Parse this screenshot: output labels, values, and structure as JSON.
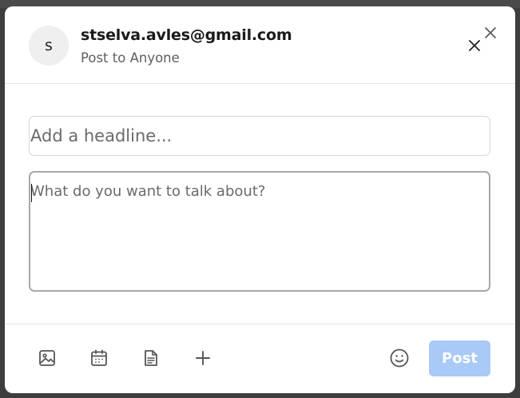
{
  "composer": {
    "user": {
      "avatar_initial": "s",
      "email": "stselva.avles@gmail.com",
      "audience": "Post to Anyone"
    },
    "headline": {
      "placeholder": "Add a headline...",
      "value": ""
    },
    "body": {
      "placeholder": "What do you want to talk about?",
      "value": ""
    },
    "toolbar": {
      "icons": [
        "image-icon",
        "calendar-icon",
        "document-icon",
        "plus-icon",
        "emoji-icon"
      ],
      "post_label": "Post",
      "post_enabled": false
    },
    "colors": {
      "post_button_disabled": "#a9c9f6",
      "icon": "#555555"
    }
  }
}
